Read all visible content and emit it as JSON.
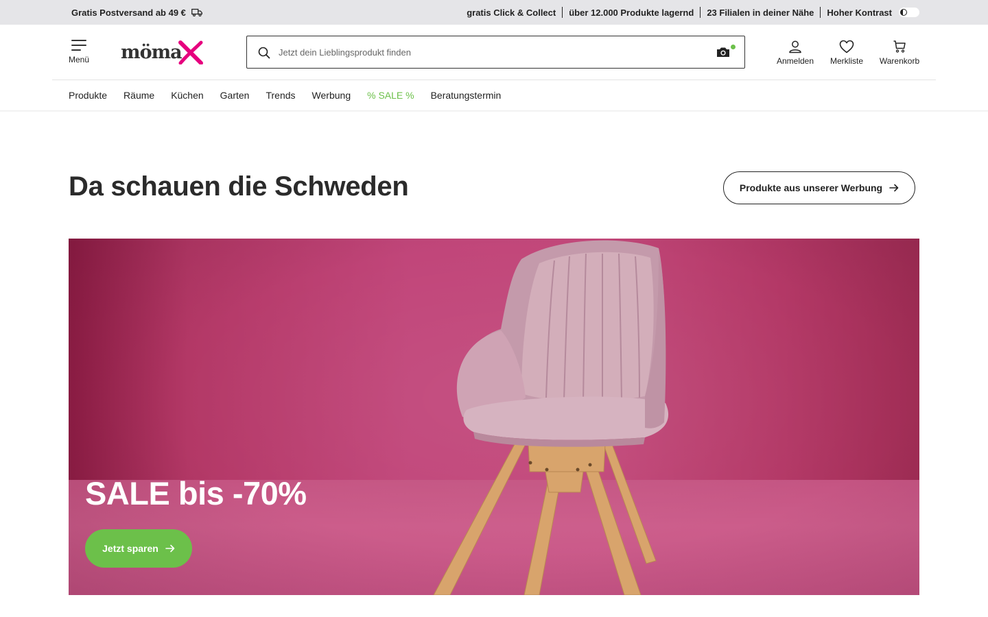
{
  "topbar": {
    "shipping": "Gratis Postversand ab 49 €",
    "links": [
      "gratis Click & Collect",
      "über 12.000 Produkte lagernd",
      "23 Filialen in deiner Nähe"
    ],
    "contrast_label": "Hoher Kontrast"
  },
  "header": {
    "menu_label": "Menü",
    "logo_text": "möma",
    "search_placeholder": "Jetzt dein Lieblingsprodukt finden",
    "login_label": "Anmelden",
    "wishlist_label": "Merkliste",
    "cart_label": "Warenkorb"
  },
  "nav": {
    "items": [
      "Produkte",
      "Räume",
      "Küchen",
      "Garten",
      "Trends",
      "Werbung",
      "% SALE %",
      "Beratungstermin"
    ]
  },
  "section": {
    "title": "Da schauen die Schweden",
    "cta_label": "Produkte aus unserer Werbung"
  },
  "hero": {
    "title": "SALE bis -70%",
    "button_label": "Jetzt sparen"
  },
  "colors": {
    "accent_green": "#6cc04a",
    "brand_magenta": "#e6007e",
    "hero_pink": "#c2487a"
  }
}
